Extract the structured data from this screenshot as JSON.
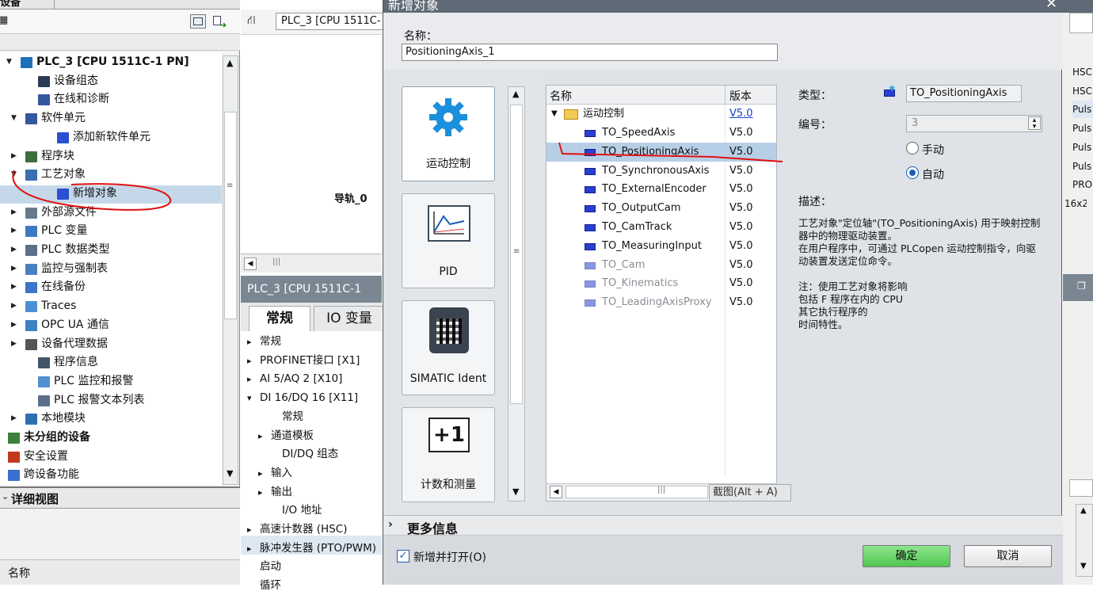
{
  "left_panel": {
    "tab": "设备",
    "tree": [
      {
        "label": "PLC_3 [CPU 1511C-1 PN]",
        "bold": true
      },
      {
        "label": "设备组态"
      },
      {
        "label": "在线和诊断"
      },
      {
        "label": "软件单元"
      },
      {
        "label": "添加新软件单元"
      },
      {
        "label": "程序块"
      },
      {
        "label": "工艺对象"
      },
      {
        "label": "新增对象"
      },
      {
        "label": "外部源文件"
      },
      {
        "label": "PLC 变量"
      },
      {
        "label": "PLC 数据类型"
      },
      {
        "label": "监控与强制表"
      },
      {
        "label": "在线备份"
      },
      {
        "label": "Traces"
      },
      {
        "label": "OPC UA 通信"
      },
      {
        "label": "设备代理数据"
      },
      {
        "label": "程序信息"
      },
      {
        "label": "PLC 监控和报警"
      },
      {
        "label": "PLC 报警文本列表"
      },
      {
        "label": "本地模块"
      },
      {
        "label": "未分组的设备",
        "bold": true
      },
      {
        "label": "安全设置"
      },
      {
        "label": "跨设备功能"
      }
    ],
    "detail_view": "详细视图",
    "detail_col_name": "名称"
  },
  "middle_panel": {
    "device_title": "PLC_3 [CPU 1511C-",
    "canvas_label": "导轨_0",
    "props_title": "PLC_3 [CPU 1511C-1",
    "tab_general": "常规",
    "tab_io": "IO 变量",
    "nav": [
      {
        "label": "常规",
        "indent": 0,
        "arrow": "▸"
      },
      {
        "label": "PROFINET接口 [X1]",
        "indent": 0,
        "arrow": "▸"
      },
      {
        "label": "AI 5/AQ 2 [X10]",
        "indent": 0,
        "arrow": "▸"
      },
      {
        "label": "DI 16/DQ 16 [X11]",
        "indent": 0,
        "arrow": "▾"
      },
      {
        "label": "常规",
        "indent": 2,
        "arrow": ""
      },
      {
        "label": "通道模板",
        "indent": 1,
        "arrow": "▸"
      },
      {
        "label": "DI/DQ 组态",
        "indent": 2,
        "arrow": ""
      },
      {
        "label": "输入",
        "indent": 1,
        "arrow": "▸"
      },
      {
        "label": "输出",
        "indent": 1,
        "arrow": "▸"
      },
      {
        "label": "I/O 地址",
        "indent": 2,
        "arrow": ""
      },
      {
        "label": "高速计数器 (HSC)",
        "indent": 0,
        "arrow": "▸"
      },
      {
        "label": "脉冲发生器 (PTO/PWM)",
        "indent": 0,
        "arrow": "▸"
      },
      {
        "label": "启动",
        "indent": 0,
        "arrow": ""
      },
      {
        "label": "循环",
        "indent": 0,
        "arrow": ""
      }
    ]
  },
  "dialog": {
    "title": "新增对象",
    "close": "✕",
    "name_label": "名称：",
    "name_value": "PositioningAxis_1",
    "categories": [
      "运动控制",
      "PID",
      "SIMATIC Ident",
      "计数和测量"
    ],
    "col_name": "名称",
    "col_version": "版本",
    "folder": {
      "name": "运动控制",
      "version": "V5.0"
    },
    "objects": [
      {
        "name": "TO_SpeedAxis",
        "version": "V5.0",
        "faded": false
      },
      {
        "name": "TO_PositioningAxis",
        "version": "V5.0",
        "faded": false
      },
      {
        "name": "TO_SynchronousAxis",
        "version": "V5.0",
        "faded": false
      },
      {
        "name": "TO_ExternalEncoder",
        "version": "V5.0",
        "faded": false
      },
      {
        "name": "TO_OutputCam",
        "version": "V5.0",
        "faded": false
      },
      {
        "name": "TO_CamTrack",
        "version": "V5.0",
        "faded": false
      },
      {
        "name": "TO_MeasuringInput",
        "version": "V5.0",
        "faded": false
      },
      {
        "name": "TO_Cam",
        "version": "V5.0",
        "faded": true
      },
      {
        "name": "TO_Kinematics",
        "version": "V5.0",
        "faded": true
      },
      {
        "name": "TO_LeadingAxisProxy",
        "version": "V5.0",
        "faded": true
      }
    ],
    "tooltip": "截图(Alt + A)",
    "type_label": "类型：",
    "type_value": "TO_PositioningAxis",
    "number_label": "编号：",
    "number_value": "3",
    "radio_manual": "手动",
    "radio_auto": "自动",
    "desc_label": "描述：",
    "description": "工艺对象\"定位轴\"(TO_PositioningAxis) 用于映射控制器中的物理驱动装置。\n在用户程序中，可通过 PLCopen 运动控制指令，向驱动装置发送定位命令。\n\n注：使用工艺对象将影响\n包括 F 程序在内的 CPU\n其它执行程序的\n时间特性。",
    "more_info": "更多信息",
    "add_open": "新增并打开(O)",
    "ok": "确定",
    "cancel": "取消"
  },
  "right_panel": {
    "items": [
      "HSC",
      "HSC",
      "Puls",
      "Puls",
      "Puls",
      "Puls",
      "PRO",
      "16x2"
    ]
  },
  "colors": {
    "accent_blue": "#2a3fd2",
    "annotation_red": "#e01010",
    "ok_green": "#5bd35b"
  }
}
